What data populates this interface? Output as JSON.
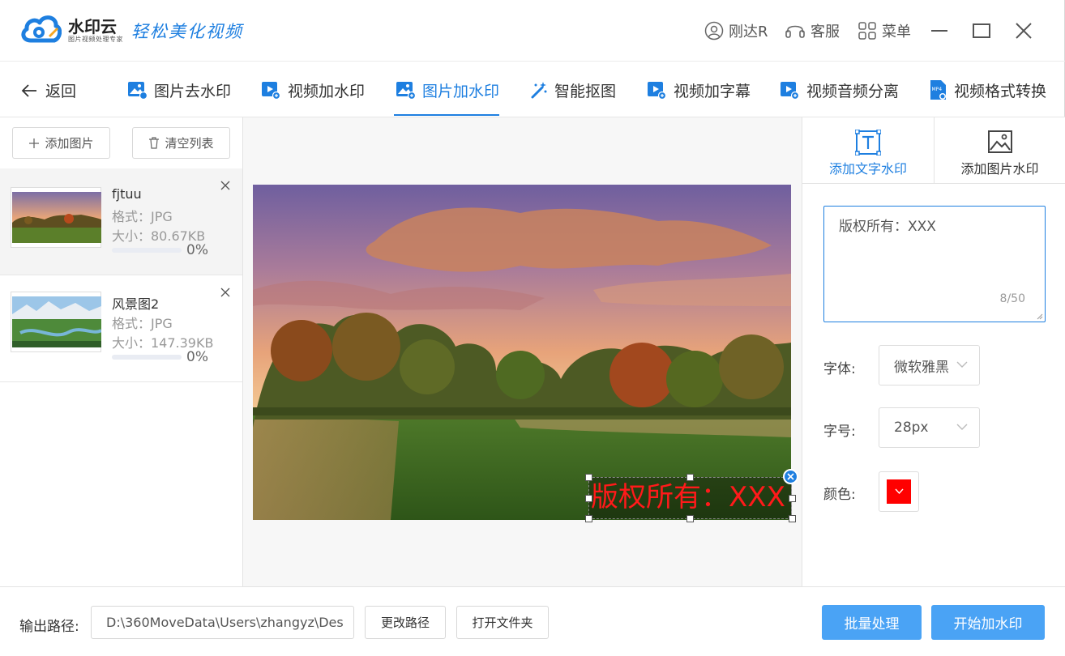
{
  "app": {
    "brand": "水印云",
    "brand_sub": "图片视频处理专家",
    "slogan": "轻松美化视频",
    "user": "刚达R",
    "service": "客服",
    "menu": "菜单"
  },
  "nav": {
    "back": "返回",
    "tabs": [
      {
        "label": "图片去水印",
        "icon": "image-icon"
      },
      {
        "label": "视频加水印",
        "icon": "video-icon"
      },
      {
        "label": "图片加水印",
        "icon": "image-add-icon",
        "active": true
      },
      {
        "label": "智能抠图",
        "icon": "magic-wand-icon"
      },
      {
        "label": "视频加字幕",
        "icon": "video-icon"
      },
      {
        "label": "视频音频分离",
        "icon": "video-icon"
      },
      {
        "label": "视频格式转换",
        "icon": "mp4-file-icon",
        "badge": "MP4"
      }
    ]
  },
  "left": {
    "add_button": "添加图片",
    "clear_button": "清空列表",
    "files": [
      {
        "name": "fjtuu",
        "format": "格式：JPG",
        "size": "大小：80.67KB",
        "progress": "0%",
        "progress_value": 0
      },
      {
        "name": "风景图2",
        "format": "格式：JPG",
        "size": "大小：147.39KB",
        "progress": "0%",
        "progress_value": 0
      }
    ]
  },
  "canvas": {
    "watermark_text": "版权所有：XXX"
  },
  "right": {
    "tab_text": "添加文字水印",
    "tab_image": "添加图片水印",
    "text_value": "版权所有：XXX",
    "counter": "8/50",
    "font_label": "字体:",
    "font_value": "微软雅黑",
    "size_label": "字号:",
    "size_value": "28px",
    "color_label": "颜色:",
    "color_value": "#ff0000"
  },
  "bottom": {
    "output_label": "输出路径:",
    "output_path": "D:\\360MoveData\\Users\\zhangyz\\Des",
    "change_path": "更改路径",
    "open_folder": "打开文件夹",
    "batch": "批量处理",
    "start": "开始加水印"
  },
  "colors": {
    "accent": "#1e7fe0",
    "primary_button": "#4aa3f5",
    "watermark": "#ff1a1a"
  }
}
